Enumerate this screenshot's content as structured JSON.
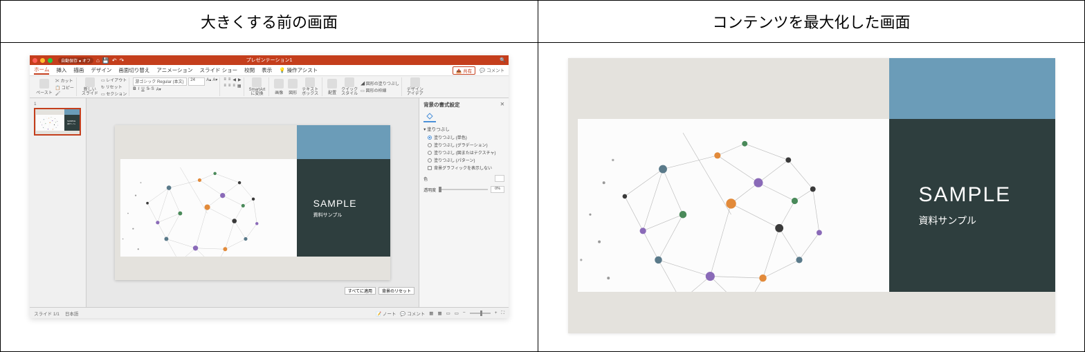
{
  "comparison": {
    "left_header": "大きくする前の画面",
    "right_header": "コンテンツを最大化した画面"
  },
  "titlebar": {
    "autosave_label": "自動保存 ● オフ",
    "doc_title": "プレゼンテーション1",
    "search_icon": "🔍"
  },
  "menubar": {
    "items": [
      "ホーム",
      "挿入",
      "描画",
      "デザイン",
      "画面切り替え",
      "アニメーション",
      "スライド ショー",
      "校閲",
      "表示"
    ],
    "operation_assist": "操作アシスト",
    "share": "共有",
    "comment": "コメント"
  },
  "ribbon": {
    "paste": "ペースト",
    "cut": "カット",
    "copy": "コピー",
    "new_slide": "新しい\nスライド",
    "layout": "レイアウト",
    "reset": "リセット",
    "section": "セクション",
    "font_name": "游ゴシック Regular (本文)",
    "font_size": "24",
    "smartart": "SmartArt\nに変換",
    "picture": "画像",
    "shapes": "図形",
    "textbox": "テキスト\nボックス",
    "arrange": "配置",
    "quick_styles": "クイック\nスタイル",
    "shape_fill": "図形の塗りつぶし",
    "shape_outline": "図形の枠線",
    "design_ideas": "デザイン\nアイデア"
  },
  "sidepanel": {
    "title": "背景の書式設定",
    "section_fill": "塗りつぶし",
    "opt_solid": "塗りつぶし (単色)",
    "opt_gradient": "塗りつぶし (グラデーション)",
    "opt_picture": "塗りつぶし (図またはテクスチャ)",
    "opt_pattern": "塗りつぶし (パターン)",
    "opt_hide_bg": "背景グラフィックを表示しない",
    "color_label": "色",
    "transparency_label": "透明度",
    "transparency_value": "0%",
    "apply_all": "すべてに適用",
    "reset_bg": "背景のリセット"
  },
  "slide": {
    "title": "SAMPLE",
    "subtitle": "資料サンプル"
  },
  "statusbar": {
    "slide_info": "スライド 1/1",
    "language": "日本語",
    "notes": "ノート",
    "comments": "コメント"
  },
  "thumbnail": {
    "number": "1"
  }
}
